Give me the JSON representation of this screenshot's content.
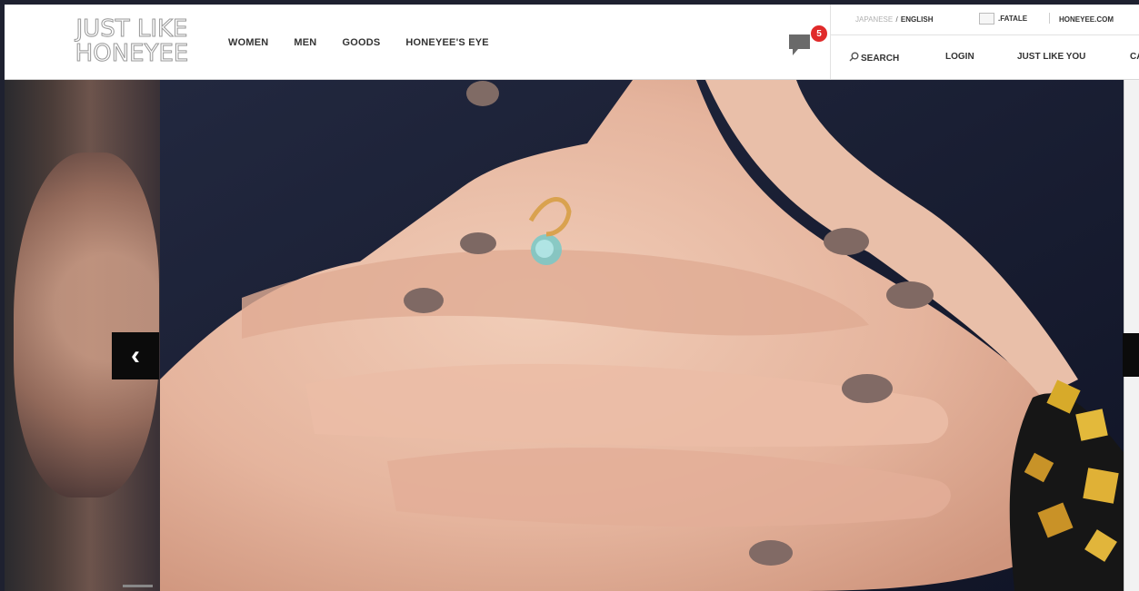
{
  "brand": {
    "logo_line1": "JUST LIKE",
    "logo_line2": "HONEYEE"
  },
  "nav": {
    "items": [
      {
        "label": "WOMEN"
      },
      {
        "label": "MEN"
      },
      {
        "label": "GOODS"
      },
      {
        "label": "HONEYEE'S EYE"
      }
    ]
  },
  "notifications": {
    "count": "5",
    "icon": "speech-bubble-icon"
  },
  "header_meta": {
    "lang_japanese": "JAPANESE",
    "lang_separator": "/",
    "lang_english": "ENGLISH",
    "fatale": ".FATALE",
    "honeyee": "HONEYEE.COM"
  },
  "subnav": {
    "search": "SEARCH",
    "login": "LOGIN",
    "just_like_you": "JUST LIKE YOU",
    "cart_partial": "CA"
  },
  "carousel": {
    "prev_arrow": "‹"
  },
  "colors": {
    "header_bg": "#ffffff",
    "page_bg": "#1e2130",
    "badge": "#e02a2a",
    "arrow_bg": "#0b0b0b"
  }
}
